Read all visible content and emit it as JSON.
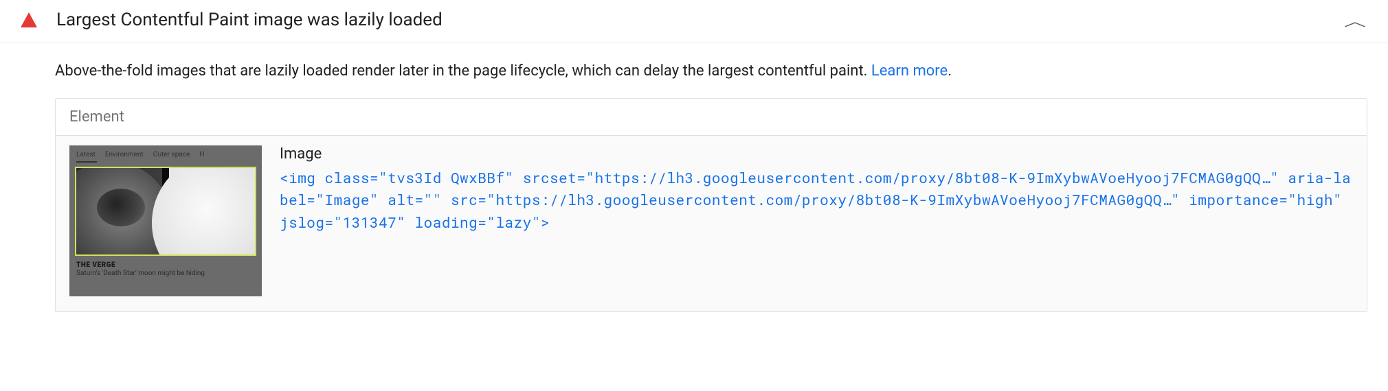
{
  "audit": {
    "title": "Largest Contentful Paint image was lazily loaded",
    "description_prefix": "Above-the-fold images that are lazily loaded render later in the page lifecycle, which can delay the largest contentful paint. ",
    "learn_more": "Learn more",
    "description_suffix": "."
  },
  "table": {
    "header": "Element",
    "row": {
      "label": "Image",
      "code": "<img class=\"tvs3Id QwxBBf\" srcset=\"https://lh3.googleusercontent.com/proxy/8bt08-K-9ImXybwAVoeHyooj7FCMAG0gQQ…\" aria-label=\"Image\" alt=\"\" src=\"https://lh3.googleusercontent.com/proxy/8bt08-K-9ImXybwAVoeHyooj7FCMAG0gQQ…\" importance=\"high\" jslog=\"131347\" loading=\"lazy\">"
    }
  },
  "thumbnail": {
    "tabs": [
      "Latest",
      "Environment",
      "Outer space",
      "H"
    ],
    "source": "THE VERGE",
    "headline": "Saturn's 'Death Star' moon might be hiding"
  }
}
